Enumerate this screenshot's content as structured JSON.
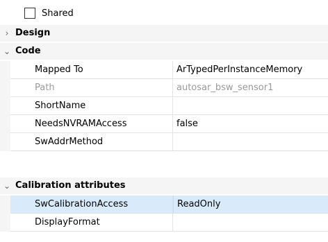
{
  "shared": {
    "label": "Shared",
    "checked": false
  },
  "sections": {
    "design": {
      "title": "Design",
      "expanded": false
    },
    "code": {
      "title": "Code",
      "expanded": true,
      "rows": [
        {
          "name": "Mapped To",
          "value": "ArTypedPerInstanceMemory",
          "enabled": true
        },
        {
          "name": "Path",
          "value": "autosar_bsw_sensor1",
          "enabled": false
        },
        {
          "name": "ShortName",
          "value": "",
          "enabled": true
        },
        {
          "name": "NeedsNVRAMAccess",
          "value": "false",
          "enabled": true
        },
        {
          "name": "SwAddrMethod",
          "value": "",
          "enabled": true
        }
      ]
    },
    "calibration": {
      "title": "Calibration attributes",
      "expanded": true,
      "rows": [
        {
          "name": "SwCalibrationAccess",
          "value": "ReadOnly",
          "enabled": true,
          "selected": true
        },
        {
          "name": "DisplayFormat",
          "value": "",
          "enabled": true
        }
      ]
    }
  },
  "icons": {
    "collapsed": "chevron-right-icon",
    "expanded": "chevron-down-icon"
  },
  "colors": {
    "selection": "#d9ebfb",
    "section_bg": "#f5f5f5",
    "disabled_text": "#9a9a9a"
  }
}
